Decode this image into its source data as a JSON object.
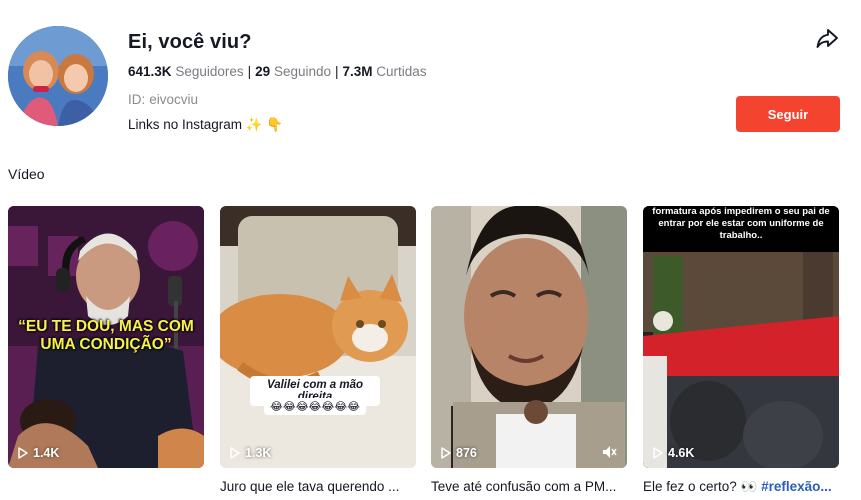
{
  "profile": {
    "name": "Ei, você viu?",
    "followers": "641.3K",
    "followers_label": "Seguidores",
    "following": "29",
    "following_label": "Seguindo",
    "likes": "7.3M",
    "likes_label": "Curtidas",
    "id_label": "ID:",
    "id_value": "eivocviu",
    "bio": "Links no Instagram ✨ 👇",
    "follow_label": "Seguir"
  },
  "section_title": "Vídeo",
  "videos": [
    {
      "views": "1.4K",
      "caption": "",
      "overlay": "“EU TE DOU, MAS COM UMA CONDIÇÃO”"
    },
    {
      "views": "1.3K",
      "caption": "Juro que ele tava querendo ...",
      "sticker": "Valilei com a mão direita",
      "sticker_emojis": "😂😂😂😂😂😂😂"
    },
    {
      "views": "876",
      "caption": "Teve até confusão com a PM..."
    },
    {
      "views": "4.6K",
      "caption_text": "Ele fez o certo? 👀 ",
      "caption_hash": "#reflexão...",
      "overlay": "formatura após impedirem o seu pai de entrar por ele estar com uniforme de trabalho.."
    }
  ],
  "colors": {
    "accent": "#f4442f",
    "hashtag": "#2b5db9",
    "overlay_yellow": "#f7f14a"
  },
  "icons": {
    "share": "share-arrow-icon",
    "play": "play-icon",
    "mute": "mute-icon"
  }
}
